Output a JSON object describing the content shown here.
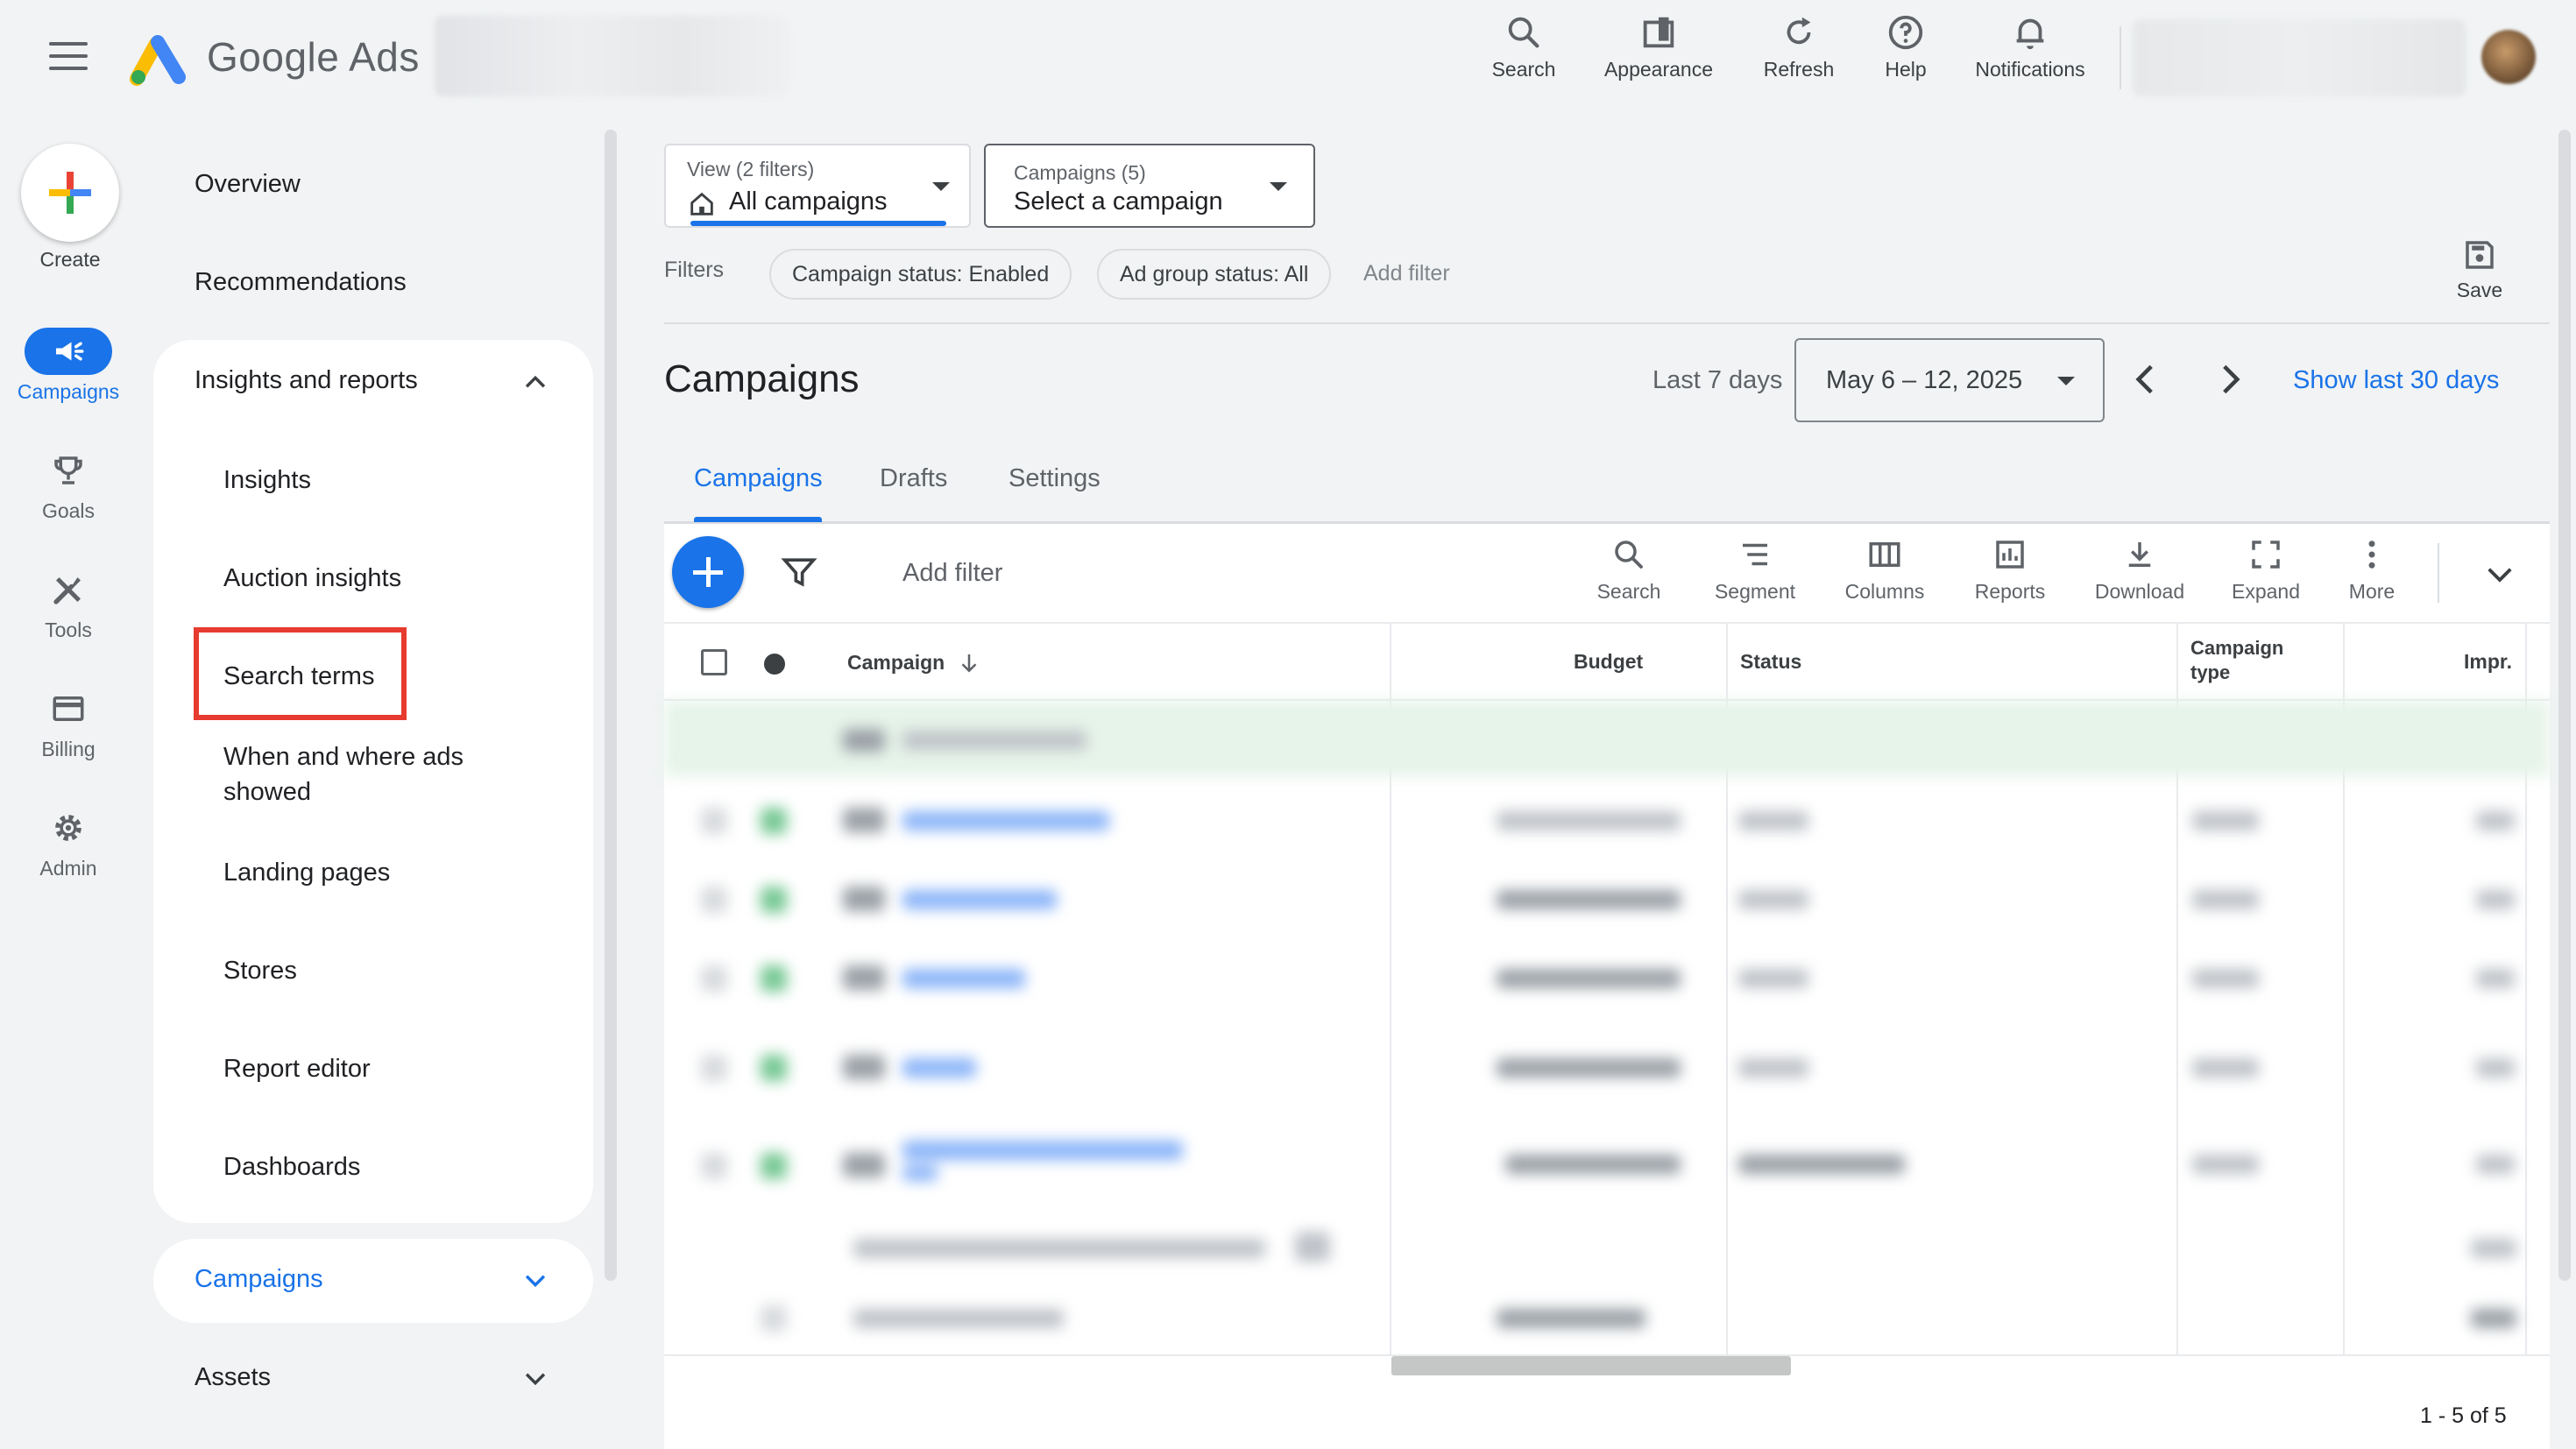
{
  "header": {
    "brand": "Google Ads",
    "tools": [
      {
        "label": "Search",
        "icon": "search-icon"
      },
      {
        "label": "Appearance",
        "icon": "appearance-icon"
      },
      {
        "label": "Refresh",
        "icon": "refresh-icon"
      },
      {
        "label": "Help",
        "icon": "help-icon"
      },
      {
        "label": "Notifications",
        "icon": "bell-icon"
      }
    ]
  },
  "rail": {
    "create": "Create",
    "items": [
      {
        "label": "Campaigns",
        "icon": "megaphone-icon",
        "active": true
      },
      {
        "label": "Goals",
        "icon": "trophy-icon"
      },
      {
        "label": "Tools",
        "icon": "tools-icon"
      },
      {
        "label": "Billing",
        "icon": "credit-card-icon"
      },
      {
        "label": "Admin",
        "icon": "gear-icon"
      }
    ]
  },
  "nav": {
    "overview": "Overview",
    "recommendations": "Recommendations",
    "section_title": "Insights and reports",
    "sub_items": [
      "Insights",
      "Auction insights",
      "Search terms",
      "When and where ads\nshowed",
      "Landing pages",
      "Stores",
      "Report editor",
      "Dashboards"
    ],
    "highlighted": "Search terms",
    "campaigns": "Campaigns",
    "assets": "Assets"
  },
  "main": {
    "view_caption": "View (2 filters)",
    "view_value": "All campaigns",
    "campaign_caption": "Campaigns (5)",
    "campaign_value": "Select a campaign",
    "filters_label": "Filters",
    "chips": [
      "Campaign status: Enabled",
      "Ad group status: All"
    ],
    "add_filter": "Add filter",
    "save": "Save",
    "title": "Campaigns",
    "range_label": "Last 7 days",
    "date_range": "May 6 – 12, 2025",
    "show_last": "Show last 30 days",
    "tabs": [
      "Campaigns",
      "Drafts",
      "Settings"
    ],
    "active_tab": "Campaigns"
  },
  "table": {
    "add_filter": "Add filter",
    "tools": [
      {
        "label": "Search",
        "icon": "search-icon"
      },
      {
        "label": "Segment",
        "icon": "segment-icon"
      },
      {
        "label": "Columns",
        "icon": "columns-icon"
      },
      {
        "label": "Reports",
        "icon": "reports-icon"
      },
      {
        "label": "Download",
        "icon": "download-icon"
      },
      {
        "label": "Expand",
        "icon": "expand-icon"
      },
      {
        "label": "More",
        "icon": "more-vert-icon"
      }
    ],
    "columns": [
      "Campaign",
      "Budget",
      "Status",
      "Campaign\ntype",
      "Impr."
    ],
    "pagination": "1 - 5 of 5"
  },
  "colors": {
    "accent": "#1a73e8",
    "highlight": "#e63b2e",
    "total_row": "#e6f4ea"
  }
}
